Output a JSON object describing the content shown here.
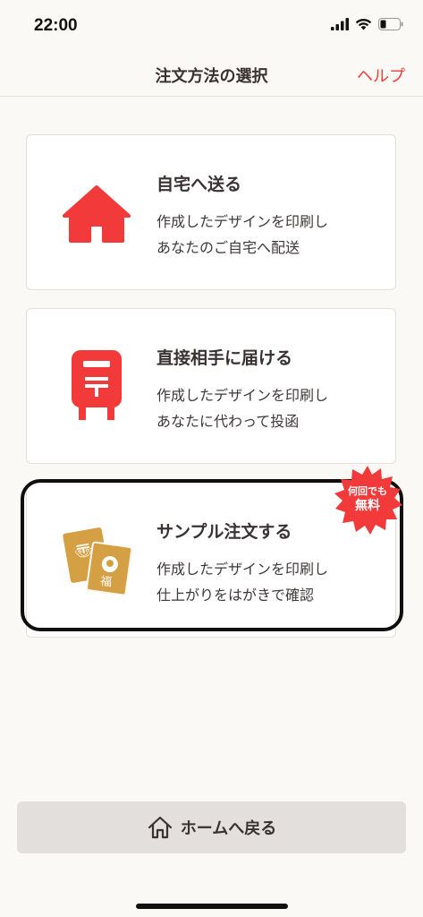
{
  "status_bar": {
    "time": "22:00"
  },
  "nav": {
    "title": "注文方法の選択",
    "help": "ヘルプ"
  },
  "options": [
    {
      "title": "自宅へ送る",
      "desc1": "作成したデザインを印刷し",
      "desc2": "あなたのご自宅へ配送",
      "icon": "house-icon"
    },
    {
      "title": "直接相手に届ける",
      "desc1": "作成したデザインを印刷し",
      "desc2": "あなたに代わって投函",
      "icon": "mailbox-icon"
    },
    {
      "title": "サンプル注文する",
      "desc1": "作成したデザインを印刷し",
      "desc2": "仕上がりをはがきで確認",
      "icon": "postcards-icon",
      "badge1": "何回でも",
      "badge2": "無料"
    }
  ],
  "home_button": {
    "label": "ホームへ戻る",
    "icon": "home-outline-icon"
  },
  "colors": {
    "accent": "#f23a3a",
    "card_icon_red": "#f23a3a",
    "postcard": "#d4a043",
    "background": "#fbf9f5"
  }
}
